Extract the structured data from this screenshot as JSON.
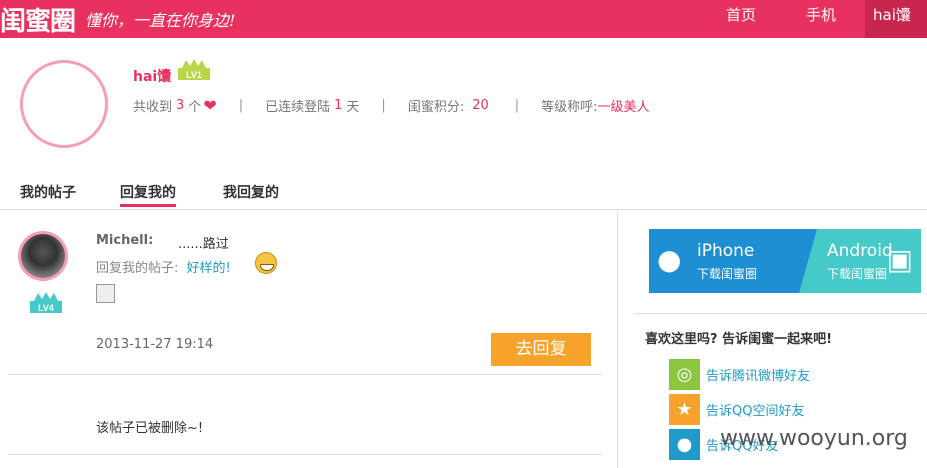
{
  "header": {
    "logo": "闺蜜圈",
    "slogan": "懂你，一直在你身边!",
    "nav": [
      {
        "label": "首页"
      },
      {
        "label": "手机"
      },
      {
        "label": "hai馕"
      }
    ]
  },
  "profile": {
    "username": "hai馕",
    "level_badge": "LV1",
    "received_prefix": "共收到",
    "received_count": "3",
    "received_unit": "个",
    "login_prefix": "已连续登陆",
    "login_days": "1",
    "login_unit": "天",
    "points_label": "闺蜜积分:",
    "points_value": "20",
    "rank_label": "等级称呼:",
    "rank_value": "一级美人"
  },
  "tabs": [
    {
      "label": "我的帖子"
    },
    {
      "label": "回复我的"
    },
    {
      "label": "我回复的"
    }
  ],
  "post": {
    "author": "Michell:",
    "body": "......路过",
    "level_badge": "LV4",
    "reply_prefix": "回复我的帖子:",
    "reply_link": "好样的!",
    "date": "2013-11-27 19:14",
    "reply_button": "去回复",
    "deleted_text": "该帖子已被删除~!"
  },
  "sidebar": {
    "ios_title": "iPhone",
    "ios_sub": "下载闺蜜圈",
    "android_title": "Android",
    "android_sub": "下载闺蜜圈",
    "share_title": "喜欢这里吗? 告诉闺蜜一起来吧!",
    "share_items": [
      {
        "label": "告诉腾讯微博好友",
        "icon": "tencent-weibo-icon",
        "color": "#8cc63e"
      },
      {
        "label": "告诉QQ空间好友",
        "icon": "qzone-icon",
        "color": "#f7a32b"
      },
      {
        "label": "告诉QQ好友",
        "icon": "qq-icon",
        "color": "#1e9bc8"
      }
    ]
  },
  "watermark": "www.wooyun.org",
  "colors": {
    "brand": "#e8315f",
    "accent_blue": "#1e9bc8",
    "button_orange": "#f7a32b"
  }
}
